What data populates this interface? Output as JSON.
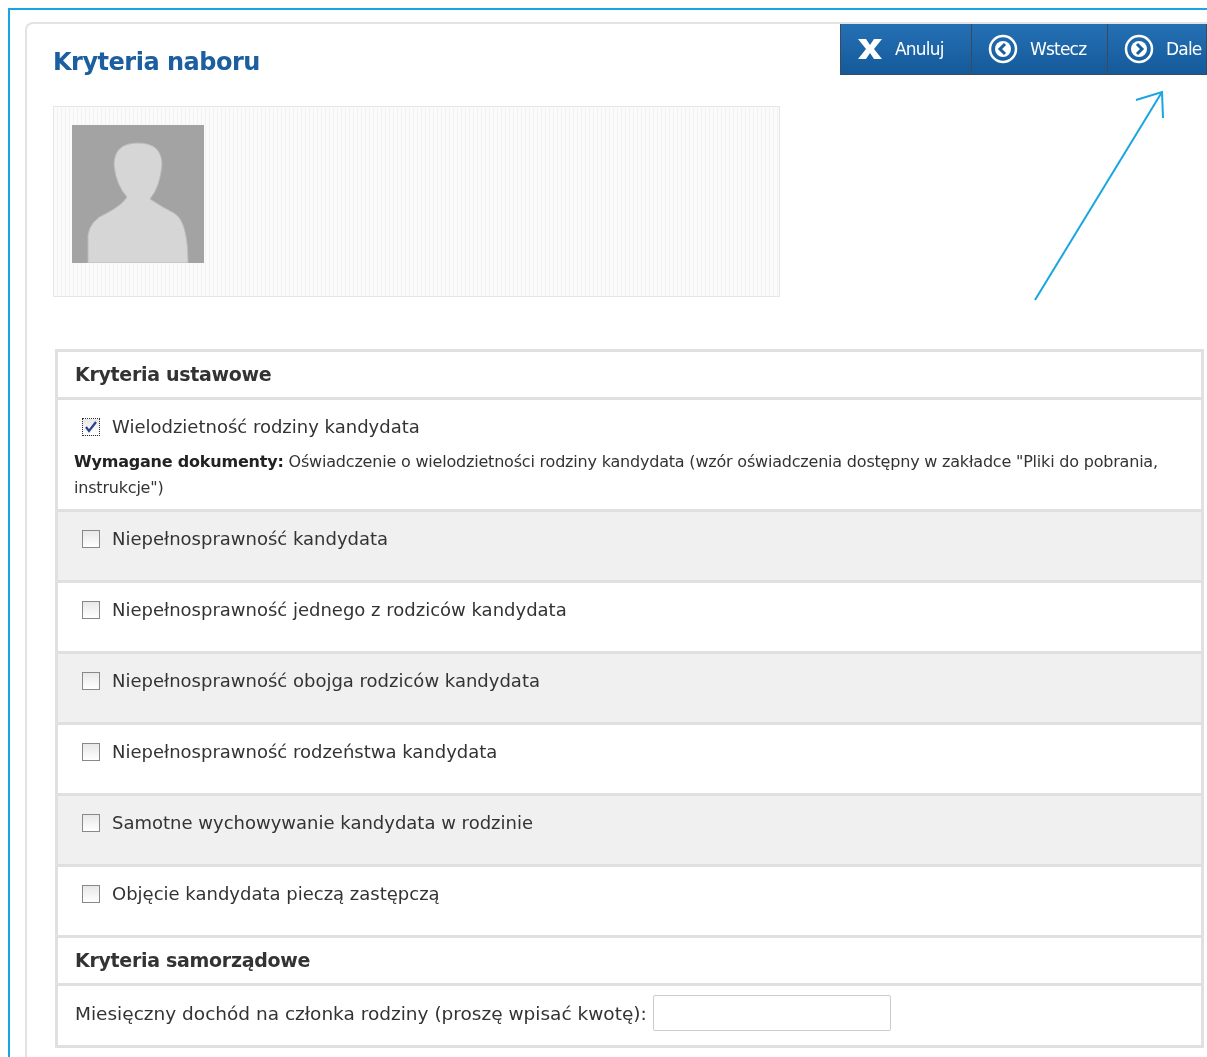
{
  "page": {
    "title": "Kryteria naboru"
  },
  "toolbar": [
    {
      "kind": "cancel",
      "label": "Anuluj"
    },
    {
      "kind": "back",
      "label": "Wstecz"
    },
    {
      "kind": "next",
      "label": "Dale"
    }
  ],
  "sections": [
    {
      "title": "Kryteria ustawowe",
      "items": [
        {
          "kind": "checkbox",
          "label": "Wielodzietność rodziny kandydata",
          "checked": true,
          "documents": "**Wymagane dokumenty:** Oświadczenie o wielodzietności rodziny kandydata (wzór oświadczenia dostępny w zakładce \"Pliki do pobrania, instrukcje\")"
        },
        {
          "kind": "checkbox",
          "label": "Niepełnosprawność kandydata",
          "checked": false
        },
        {
          "kind": "checkbox",
          "label": "Niepełnosprawność jednego z rodziców kandydata",
          "checked": false
        },
        {
          "kind": "checkbox",
          "label": "Niepełnosprawność obojga rodziców kandydata",
          "checked": false
        },
        {
          "kind": "checkbox",
          "label": "Niepełnosprawność rodzeństwa kandydata",
          "checked": false
        },
        {
          "kind": "checkbox",
          "label": "Samotne wychowywanie kandydata w rodzinie",
          "checked": false
        },
        {
          "kind": "checkbox",
          "label": "Objęcie kandydata pieczą zastępczą",
          "checked": false
        }
      ]
    },
    {
      "title": "Kryteria samorządowe",
      "items": [
        {
          "kind": "input",
          "label": "Miesięczny dochód na członka rodziny (proszę wpisać kwotę):"
        }
      ]
    }
  ]
}
